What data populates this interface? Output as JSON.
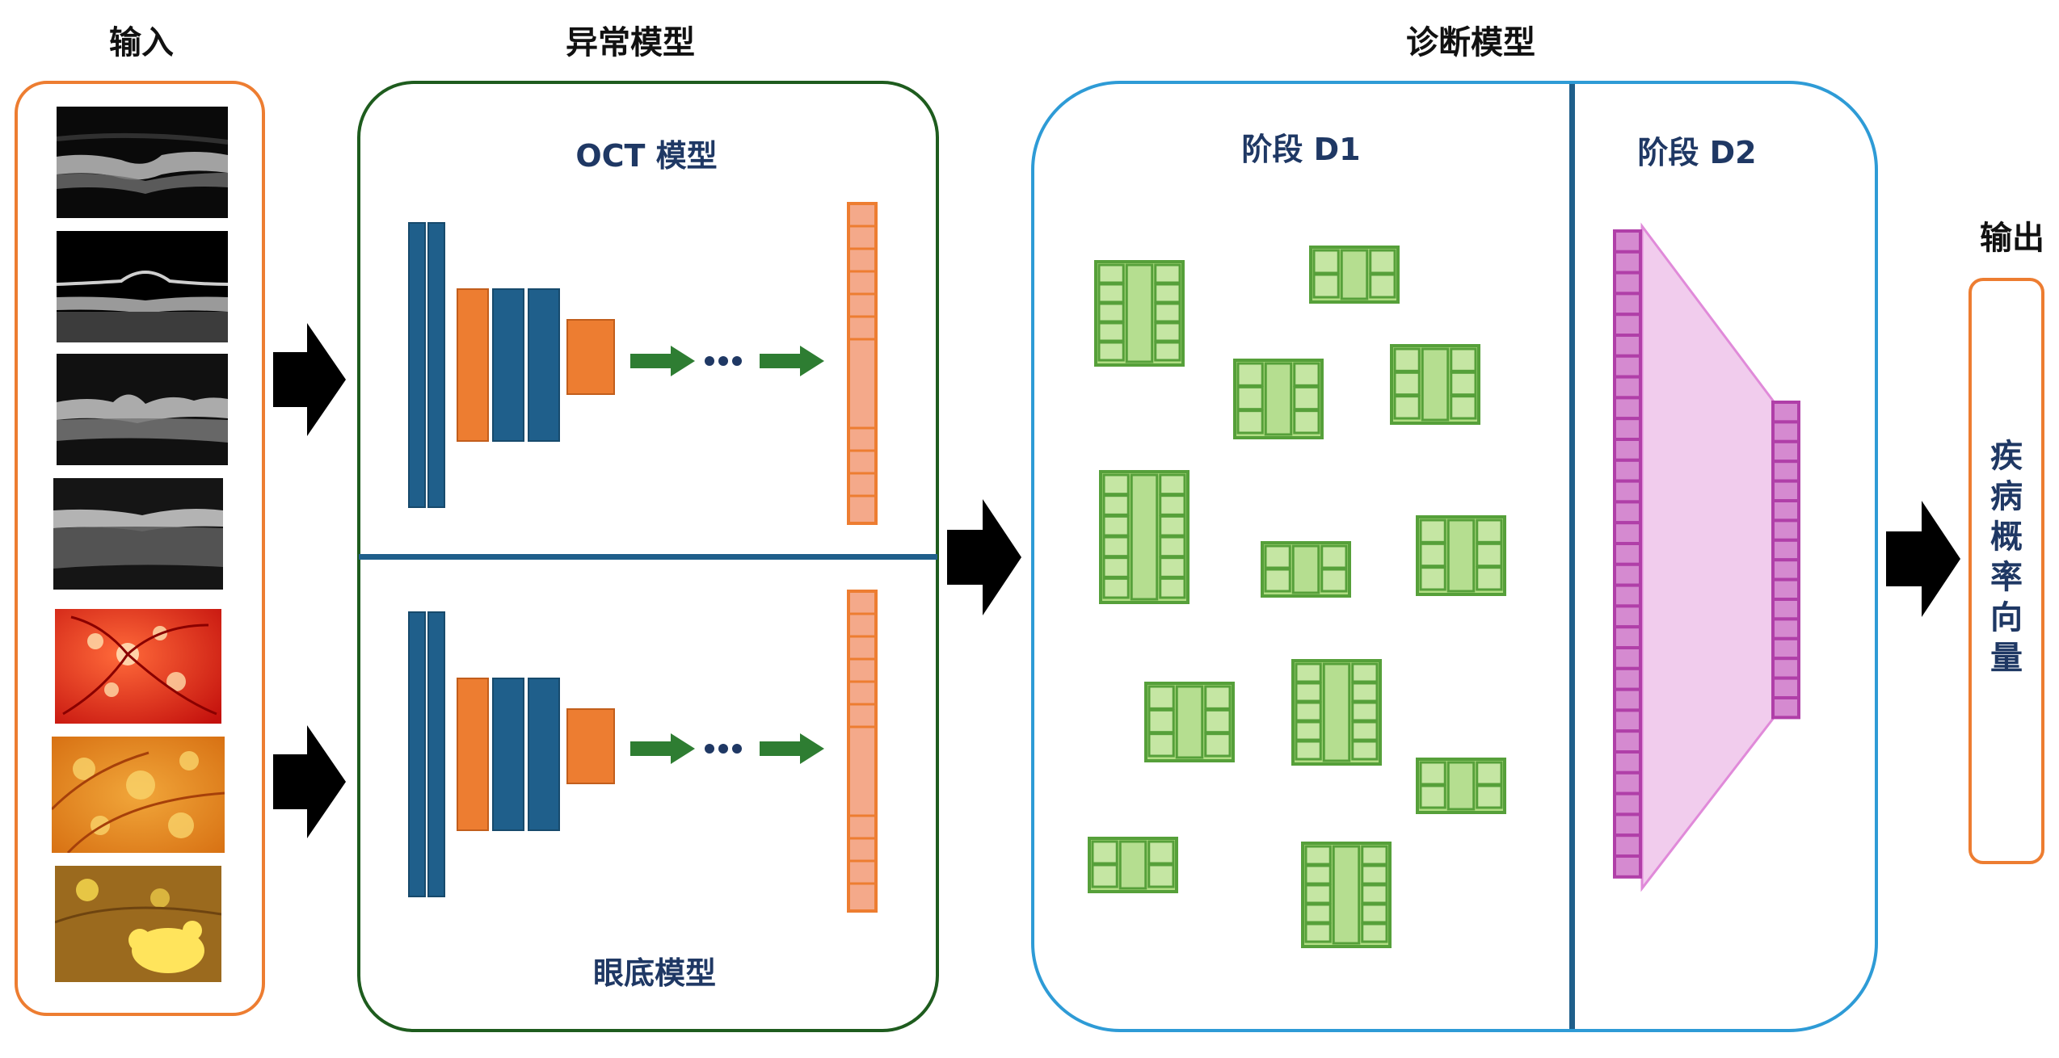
{
  "sections": {
    "input_title": "输入",
    "anomaly_title": "异常模型",
    "diagnosis_title": "诊断模型",
    "output_title": "输出"
  },
  "anomaly": {
    "oct_label": "OCT 模型",
    "fundus_label": "眼底模型"
  },
  "diagnosis": {
    "stage1_label": "阶段 D1",
    "stage2_label": "阶段 D2"
  },
  "output": {
    "chars": [
      "疾",
      "病",
      "概",
      "率",
      "向",
      "量"
    ]
  },
  "colors": {
    "input_border": "#ed7d31",
    "anomaly_border": "#1e5c1e",
    "diagnosis_border": "#2e9bd6",
    "blue_layer": "#1f5f8b",
    "orange_layer": "#ed7d31",
    "green_arrow": "#2e7d32",
    "green_block": "#92d050",
    "green_block_border": "#56a03a",
    "purple_layer": "#b03fa8",
    "pink_fill": "#efc3ea",
    "divider": "#1f5f8b"
  },
  "icons": {
    "big_arrow": "black-right-arrow",
    "small_arrow": "green-right-arrow",
    "ellipsis": "dots-icon"
  }
}
